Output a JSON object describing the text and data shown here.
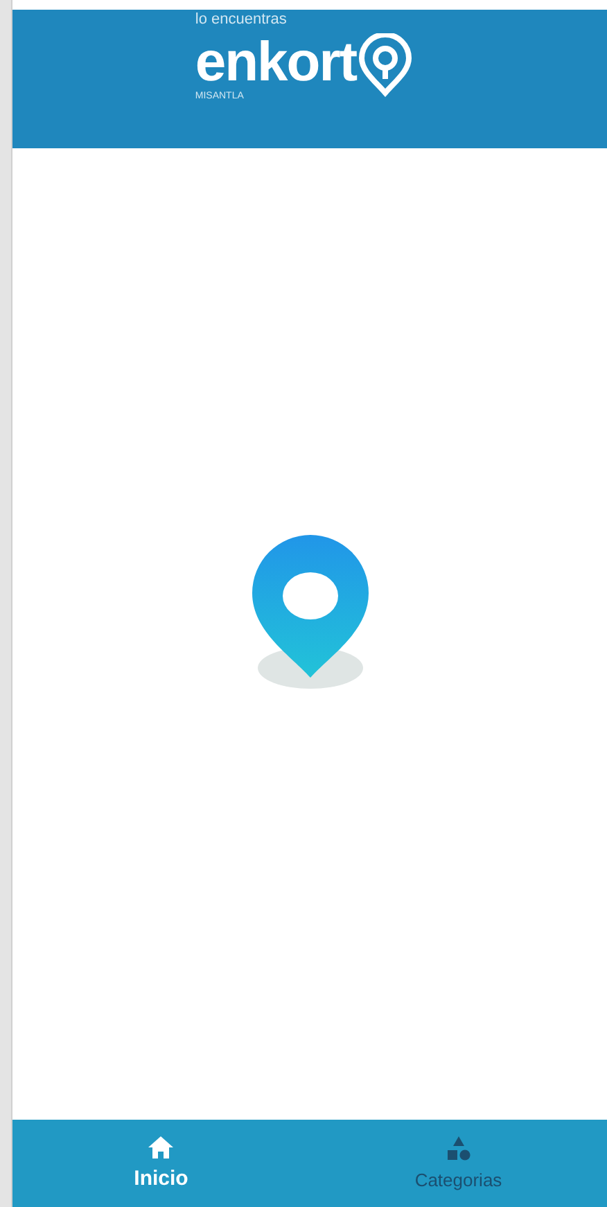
{
  "header": {
    "tagline": "lo encuentras",
    "brand": "enkort",
    "city": "MISANTLA"
  },
  "tabs": [
    {
      "label": "Inicio",
      "kind": "home",
      "selected": true
    },
    {
      "label": "Categorias",
      "kind": "categories",
      "selected": false
    }
  ]
}
